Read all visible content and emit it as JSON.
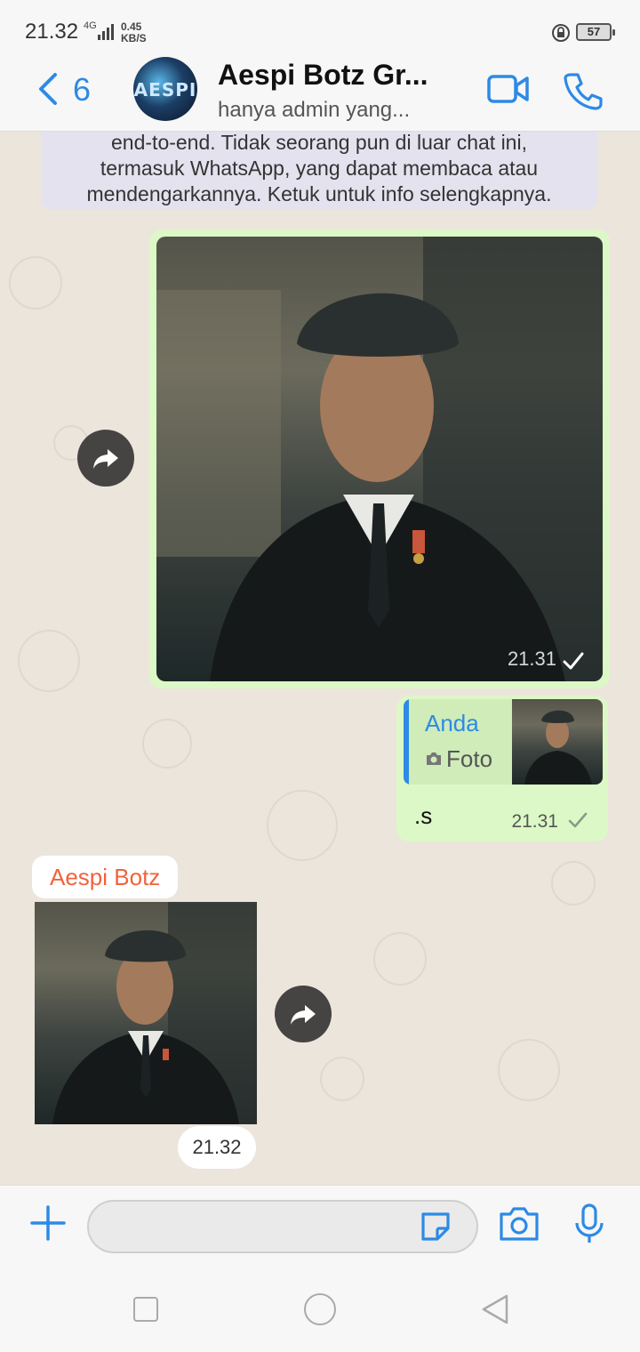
{
  "status_bar": {
    "time": "21.32",
    "network": "4G",
    "speed_value": "0.45",
    "speed_unit": "KB/S",
    "battery": "57"
  },
  "header": {
    "back_count": "6",
    "avatar_text": "AESPI",
    "title": "Aespi Botz Gr...",
    "subtitle": "hanya admin yang..."
  },
  "system_message": {
    "line1": "end-to-end. Tidak seorang pun di luar chat ini,",
    "line2": "termasuk WhatsApp, yang dapat membaca atau",
    "line3": "mendengarkannya. Ketuk untuk info selengkapnya."
  },
  "messages": [
    {
      "type": "image",
      "direction": "out",
      "time": "21.31",
      "status": "sent"
    },
    {
      "type": "reply",
      "direction": "out",
      "quote_name": "Anda",
      "quote_type": "Foto",
      "text": ".s",
      "time": "21.31",
      "status": "sent"
    },
    {
      "type": "image",
      "direction": "in",
      "sender": "Aespi Botz",
      "time": "21.32"
    }
  ],
  "input": {
    "placeholder": ""
  },
  "colors": {
    "accent": "#2d8ae6",
    "outgoing_bubble": "#dcf8c6",
    "sender_name": "#f0633c",
    "chat_background": "#ece5dc"
  },
  "icons": [
    "back-icon",
    "video-call-icon",
    "voice-call-icon",
    "forward-icon",
    "camera-icon",
    "plus-icon",
    "sticker-icon",
    "mic-icon",
    "check-icon"
  ]
}
